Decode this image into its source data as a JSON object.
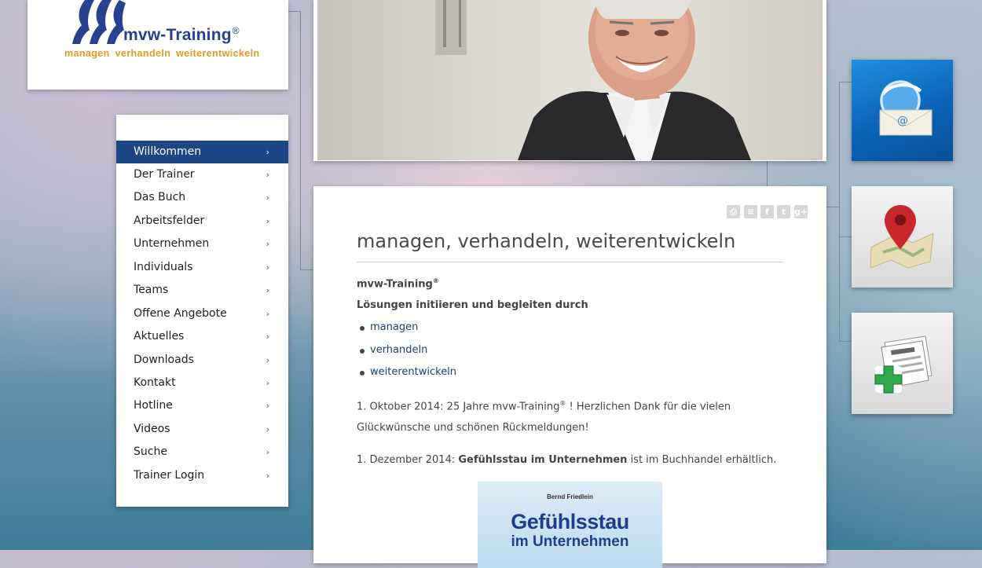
{
  "logo": {
    "name": "mvw-Training",
    "mark": "®",
    "tagline": "managen  verhandeln  weiterentwickeln"
  },
  "nav": {
    "items": [
      {
        "label": "Willkommen",
        "active": true
      },
      {
        "label": "Der Trainer"
      },
      {
        "label": "Das Buch"
      },
      {
        "label": "Arbeitsfelder"
      },
      {
        "label": "Unternehmen"
      },
      {
        "label": "Individuals"
      },
      {
        "label": "Teams"
      },
      {
        "label": "Offene Angebote"
      },
      {
        "label": "Aktuelles"
      },
      {
        "label": "Downloads"
      },
      {
        "label": "Kontakt"
      },
      {
        "label": "Hotline"
      },
      {
        "label": "Videos"
      },
      {
        "label": "Suche"
      },
      {
        "label": "Trainer Login"
      }
    ],
    "chevron": "›"
  },
  "share_icons": [
    "print-icon",
    "pdf-icon",
    "facebook-icon",
    "twitter-icon",
    "google-plus-icon"
  ],
  "content": {
    "title": "managen, verhandeln, weiterentwickeln",
    "brand": "mvw-Training",
    "brand_mark": "®",
    "intro": "Lösungen initiieren und begleiten durch",
    "links": [
      "managen",
      "verhandeln",
      "weiterentwickeln"
    ],
    "news1_pre": "1. Oktober 2014: 25 Jahre mvw-Training",
    "news1_mark": "®",
    "news1_post": " ! Herzlichen Dank für die vielen",
    "news1_line2": "Glückwünsche und schönen Rückmeldungen!",
    "news2_pre": "1. Dezember 2014:  ",
    "news2_bold": "Gefühlsstau im Unternehmen",
    "news2_post": " ist im Buchhandel erhältlich.",
    "book": {
      "author": "Bernd Friedlein",
      "title1": "Gefühlsstau",
      "title2": "im Unternehmen"
    }
  },
  "tiles": [
    "email-icon",
    "map-pin-icon",
    "news-add-icon"
  ],
  "colors": {
    "nav_active": "#1d4784",
    "logo_blue": "#27418f",
    "logo_orange": "#e49a1c",
    "link": "#1d3f7a"
  }
}
